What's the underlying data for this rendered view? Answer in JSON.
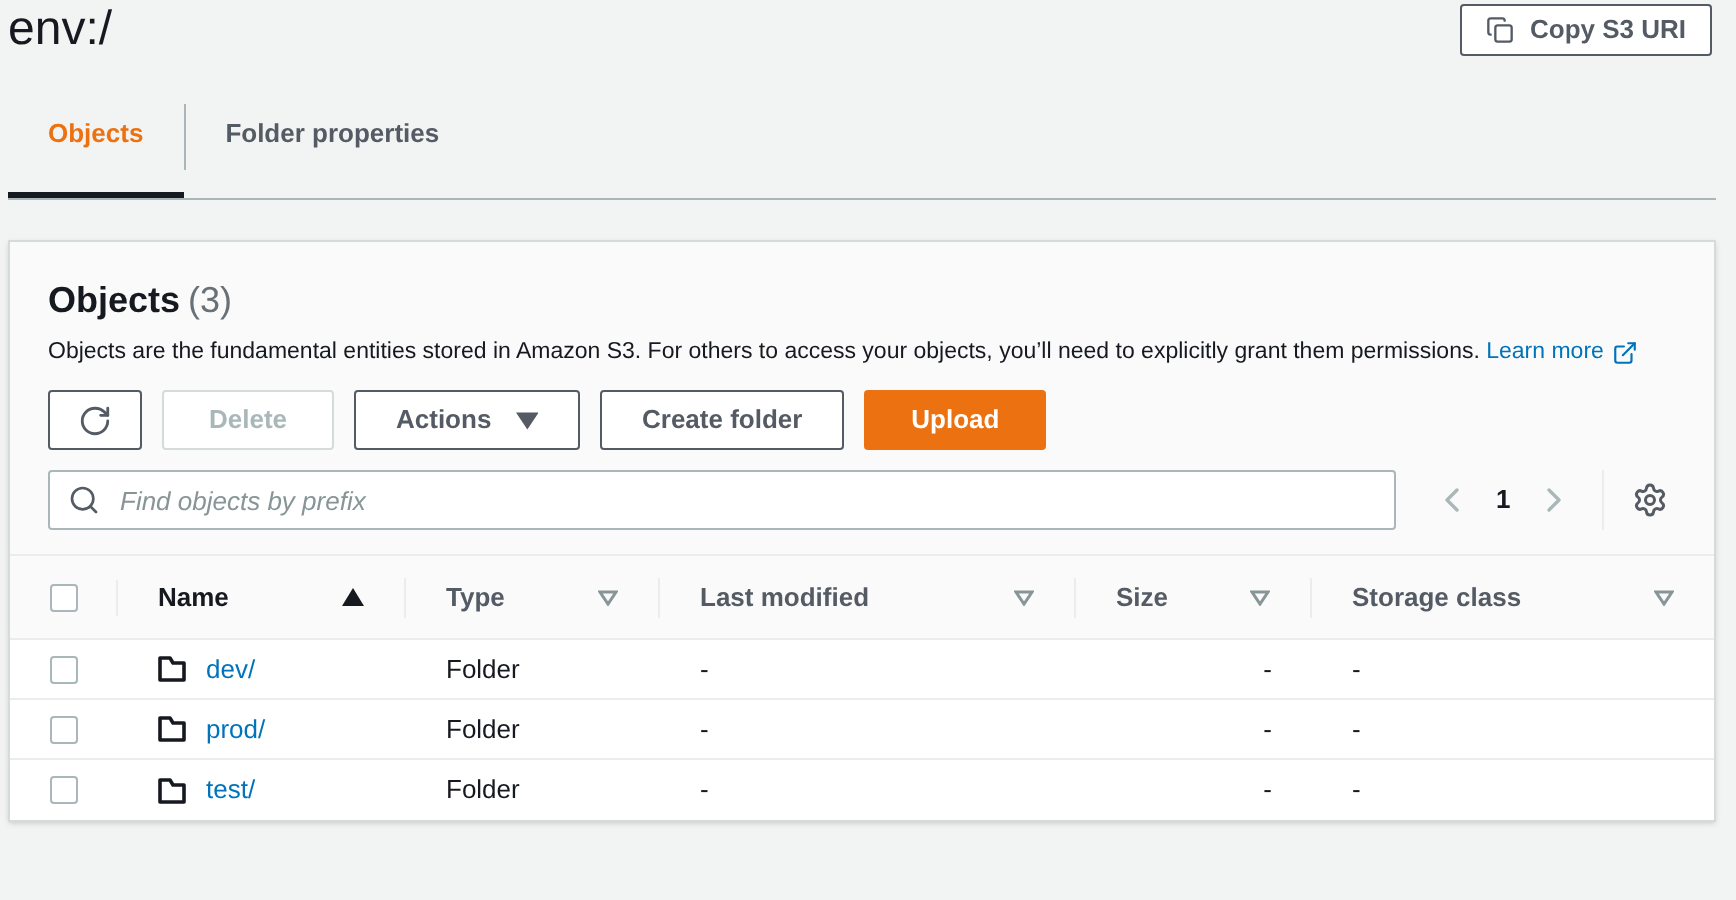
{
  "page": {
    "title": "env:/",
    "copy_button": "Copy S3 URI"
  },
  "tabs": [
    {
      "label": "Objects",
      "selected": true
    },
    {
      "label": "Folder properties",
      "selected": false
    }
  ],
  "panel": {
    "title": "Objects",
    "count": "(3)",
    "description": "Objects are the fundamental entities stored in Amazon S3. For others to access your objects, you’ll need to explicitly grant them permissions.",
    "learn_more": "Learn more",
    "buttons": [
      {
        "kind": "refresh",
        "disabled": false
      },
      {
        "kind": "plain",
        "label": "Delete",
        "disabled": true
      },
      {
        "kind": "dropdown",
        "label": "Actions",
        "disabled": false
      },
      {
        "kind": "plain",
        "label": "Create folder",
        "disabled": false
      },
      {
        "kind": "primary",
        "label": "Upload",
        "disabled": false
      }
    ],
    "search": {
      "placeholder": "Find objects by prefix"
    },
    "pagination": {
      "page": "1"
    }
  },
  "table": {
    "select_all_checked": false,
    "columns": [
      {
        "label": "Name",
        "sorted": true
      },
      {
        "label": "Type",
        "sorted": false
      },
      {
        "label": "Last modified",
        "sorted": false
      },
      {
        "label": "Size",
        "sorted": false
      },
      {
        "label": "Storage class",
        "sorted": false
      }
    ],
    "rows": [
      {
        "name": "dev/",
        "type": "Folder",
        "last_modified": "-",
        "size": "-",
        "storage_class": "-",
        "checked": false
      },
      {
        "name": "prod/",
        "type": "Folder",
        "last_modified": "-",
        "size": "-",
        "storage_class": "-",
        "checked": false
      },
      {
        "name": "test/",
        "type": "Folder",
        "last_modified": "-",
        "size": "-",
        "storage_class": "-",
        "checked": false
      }
    ]
  }
}
